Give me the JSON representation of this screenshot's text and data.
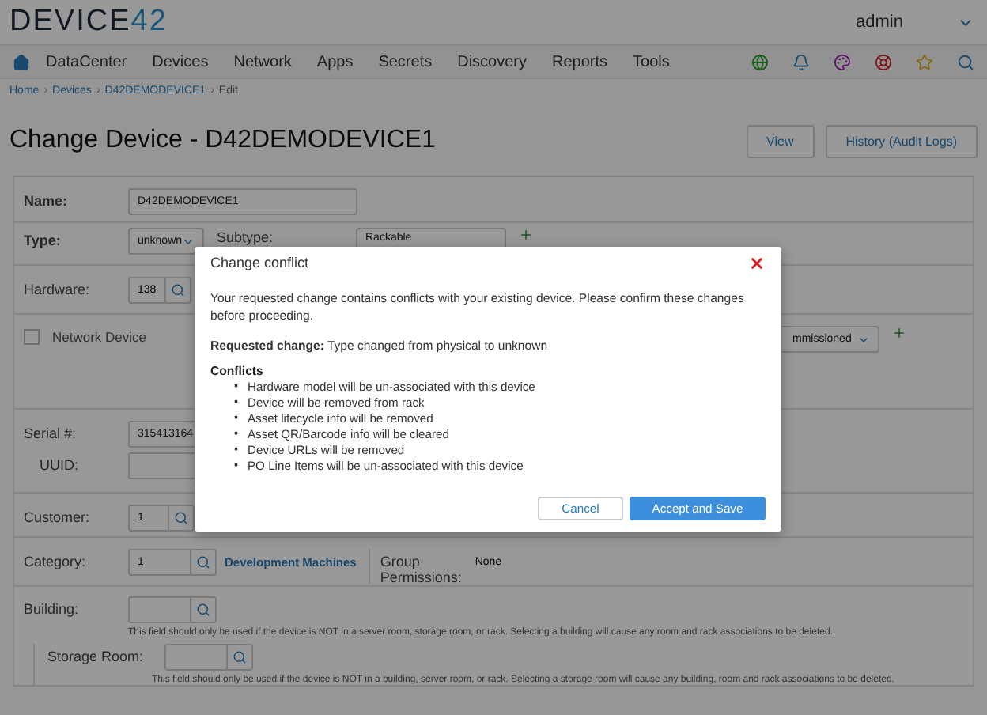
{
  "header": {
    "logo_main": "DEVICE",
    "logo_num": "42",
    "user": "admin"
  },
  "nav": {
    "items": [
      "DataCenter",
      "Devices",
      "Network",
      "Apps",
      "Secrets",
      "Discovery",
      "Reports",
      "Tools"
    ]
  },
  "breadcrumb": {
    "links": [
      "Home",
      "Devices",
      "D42DEMODEVICE1"
    ],
    "separator": "›",
    "current": "Edit"
  },
  "page": {
    "title": "Change Device - D42DEMODEVICE1",
    "buttons": [
      "View",
      "History (Audit Logs)"
    ]
  },
  "form": {
    "name": {
      "label": "Name:",
      "value": "D42DEMODEVICE1"
    },
    "type": {
      "label": "Type:",
      "value": "unknown",
      "subtype_label": "Subtype:",
      "subtype_value": "Rackable"
    },
    "hardware": {
      "label": "Hardware:",
      "value": "138"
    },
    "network_device": {
      "label": "Network Device",
      "checked": false
    },
    "status_value": "mmissioned",
    "serial": {
      "label": "Serial #:",
      "value": "315413164",
      "uuid_label": "UUID:"
    },
    "customer": {
      "label": "Customer:",
      "value": "1"
    },
    "category": {
      "label": "Category:",
      "value": "1",
      "link": "Development Machines",
      "perm_label": "Group Permissions:",
      "perm_value": "None"
    },
    "building": {
      "label": "Building:",
      "hint": "This field should only be used if the device is NOT in a server room, storage room, or rack. Selecting a building will cause any room and rack associations to be deleted."
    },
    "storage_room": {
      "label": "Storage Room:",
      "hint": "This field should only be used if the device is NOT in a building, server room, or rack. Selecting a storage room will cause any building, room and rack associations to be deleted."
    }
  },
  "dialog": {
    "title": "Change conflict",
    "intro": "Your requested change contains conflicts with your existing device. Please confirm these changes before proceeding.",
    "change": "**Requested change:** Type changed from physical to unknown",
    "conflicts_title": "Conflicts",
    "bullet": "▪",
    "conflicts": [
      "Hardware model will be un-associated with this device",
      "Device will be removed from rack",
      "Asset lifecycle info will be removed",
      "Asset QR/Barcode info will be cleared",
      "Device URLs will be removed",
      "PO Line Items will be un-associated with this device"
    ],
    "cancel": "Cancel",
    "accept": "Accept and Save"
  }
}
